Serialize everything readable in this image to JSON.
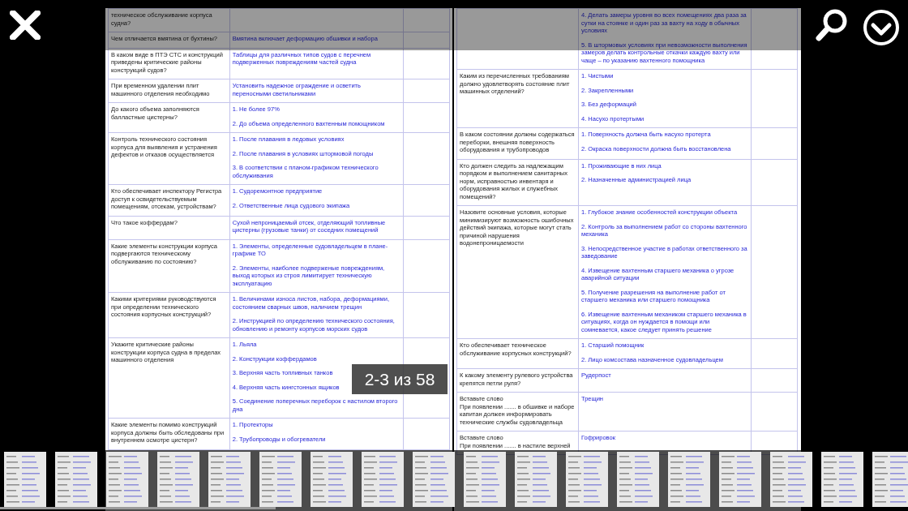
{
  "pages": [
    {
      "rows": [
        {
          "question": "техническое обслуживание корпуса судна?"
        },
        {
          "question": "Чем отличается вмятина от бухтины?",
          "answers": [
            "Вмятина включает деформацию обшивки и набора"
          ]
        },
        {
          "question": "В каком виде в ПТЭ СТС и конструкций приведены критические районы конструкций судов?",
          "answers": [
            "Таблицы для различных типов судов с перечнем подверженных повреждениям частей судна"
          ]
        },
        {
          "question": "При временном удалении плит машинного отделения необходимо",
          "answers": [
            "Установить надежное ограждение и осветить переносными светильниками"
          ]
        },
        {
          "question": "До какого объема заполняются балластные цистерны?",
          "answers": [
            "1. Не более 97%",
            "2. До объема определенного вахтенным помощником"
          ]
        },
        {
          "question": "Контроль технического состояния корпуса для выявления и устранения дефектов и отказов осуществляется",
          "answers": [
            "1. После плавания в ледовых условиях",
            "2. После плавания в условиях штормовой погоды",
            "3. В соответствии с планом-графиком технического обслуживания"
          ]
        },
        {
          "question": "Кто обеспечивает инспектору Регистра доступ к освидетельствуемым помещениям, отсекам, устройствам?",
          "answers": [
            "1. Судоремонтное предприятие",
            "2. Ответственные лица судового экипажа"
          ]
        },
        {
          "question": "Что такое коффердам?",
          "answers": [
            "Сухой непроницаемый отсек, отделяющий топливные цистерны (грузовые танки) от соседних помещений"
          ]
        },
        {
          "question": "Какие элементы конструкции корпуса подвергаются техническому обслуживанию по состоянию?",
          "answers": [
            "1. Элементы, определенные судовладельцем в плане-графике ТО",
            "2. Элементы, наиболее подверженые повреждениям, выход которых из строя лимитирует техническую эксплуатацию"
          ]
        },
        {
          "question": "Какими критериями руководствуются при определении технического состояния корпусных конструкций?",
          "answers": [
            "1. Величинами износа листов, набора, деформациями, состоянием сварных швов, наличием трещин",
            "2. Инструкцией по определению технического состояния, обновлению и ремонту корпусов морских судов"
          ]
        },
        {
          "question": "Укажите критические районы конструкции корпуса судна в пределах машинного отделения",
          "answers": [
            "1. Льяла",
            "2. Конструкции коффердамов",
            "3. Верхняя часть топливных танков",
            "4. Верхняя часть кингстонных ящиков",
            "5. Соединение поперечных переборок с настилом второго дна"
          ]
        },
        {
          "question": "Какие элементы помимо конструкций корпуса должны быть обследованы при внутреннем осмотре цистерн?",
          "answers": [
            "1. Протекторы",
            "2. Трубопроводы и обогреватели"
          ]
        }
      ]
    },
    {
      "rows": [
        {
          "answers": [
            "4. Делать замеры уровня во всех помещениях два раза за сутки на стоянке и один раз за вахту на ходу в обычных условиях",
            "5. В штормовых условиях при невозможности выполнения замеров делать контрольные откачки каждую вахту или чаще – по указанию вахтенного помощника"
          ]
        },
        {
          "question": "Каким из перечисленных требованиям должно удовлетворять состояние плит машинных отделений?",
          "answers": [
            "1. Чистыми",
            "2. Закрепленными",
            "3. Без деформаций",
            "4. Насухо протертыми"
          ]
        },
        {
          "question": "В каком состоянии должны содержаться переборки, внешняя поверхность оборудования и трубопроводов",
          "answers": [
            "1. Поверхность должна быть насухо протерта",
            "2. Окраска поверхности должна быть восстановлена"
          ]
        },
        {
          "question": "Кто должен следить за надлежащим порядком и выполнением санитарных норм, исправностью инвентаря и оборудования жилых и служебных помещений?",
          "answers": [
            "1. Проживающие в них лица",
            "2. Назначенные администрацией лица"
          ]
        },
        {
          "question": "Назовите основные условия, которые минимизируют возможность ошибочных действий экипажа, которые могут стать причиной нарушения водонепроницаемости",
          "answers": [
            "1. Глубокое знание особенностей конструкции объекта",
            "2. Контроль за выполнением работ со стороны вахтенного механика",
            "3. Непосредственное участие в работах ответственного за заведование",
            "4. Извещение вахтенным старшего механика о угрозе аварийной ситуации",
            "5. Получение разрешения на выполнение работ от старшего механика или старшего помощника",
            "6. Извещение вахтенным механиком старшего механика в ситуациях, когда он нуждается в помощи или сомневается, какое следует принять решение"
          ]
        },
        {
          "question": "Кто обеспечивает техническое обслуживание корпусных конструкций?",
          "answers": [
            "1. Старший помощник",
            "2. Лицо комсостава назначенное судовладельцем"
          ]
        },
        {
          "question": "К какому элементу рулевого устройства крепятся петли руля?",
          "answers": [
            "Рудерпост"
          ]
        },
        {
          "question": "Вставьте слово\nПри появлении ....... в обшивке и наборе капитан должен информировать технические службы судовладельца",
          "answers": [
            "Трещин"
          ]
        },
        {
          "question": "Вставьте слово\nПри появлении ....... в настиле верхней",
          "answers": [
            "Гофрировок"
          ]
        }
      ]
    }
  ],
  "page_counter": "2-3 из 58"
}
